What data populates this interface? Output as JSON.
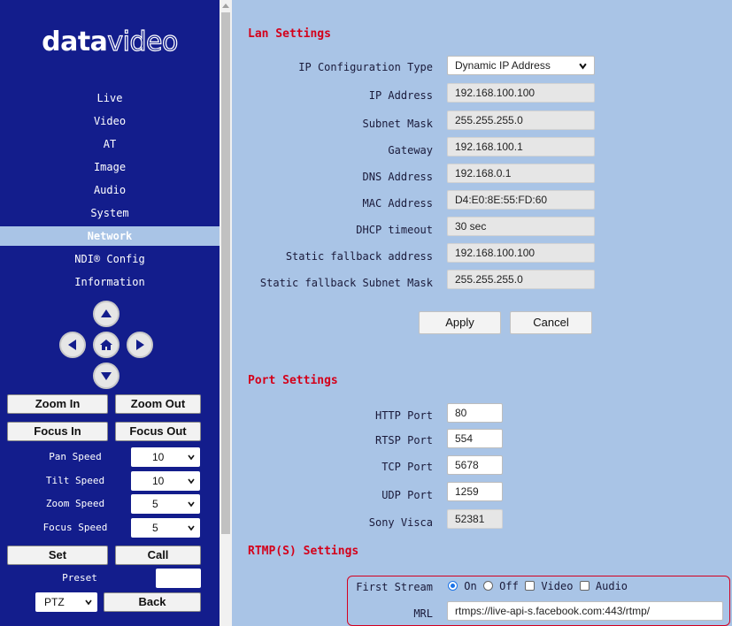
{
  "logo": {
    "bold": "data",
    "thin": "video"
  },
  "nav": {
    "items": [
      {
        "label": "Live"
      },
      {
        "label": "Video"
      },
      {
        "label": "AT"
      },
      {
        "label": "Image"
      },
      {
        "label": "Audio"
      },
      {
        "label": "System"
      },
      {
        "label": "Network",
        "active": true
      },
      {
        "label": "NDI® Config"
      },
      {
        "label": "Information"
      }
    ]
  },
  "ptz": {
    "zoom_in": "Zoom In",
    "zoom_out": "Zoom Out",
    "focus_in": "Focus In",
    "focus_out": "Focus Out",
    "pan_speed": {
      "label": "Pan Speed",
      "value": "10"
    },
    "tilt_speed": {
      "label": "Tilt Speed",
      "value": "10"
    },
    "zoom_speed": {
      "label": "Zoom Speed",
      "value": "5"
    },
    "focus_speed": {
      "label": "Focus Speed",
      "value": "5"
    },
    "set": "Set",
    "call": "Call",
    "preset_label": "Preset",
    "preset_value": "",
    "mode": "PTZ",
    "back": "Back"
  },
  "lan": {
    "title": "Lan Settings",
    "ip_config_type": {
      "label": "IP Configuration Type",
      "value": "Dynamic IP Address"
    },
    "ip_address": {
      "label": "IP Address",
      "value": "192.168.100.100"
    },
    "subnet_mask": {
      "label": "Subnet Mask",
      "value": "255.255.255.0"
    },
    "gateway": {
      "label": "Gateway",
      "value": "192.168.100.1"
    },
    "dns": {
      "label": "DNS Address",
      "value": "192.168.0.1"
    },
    "mac": {
      "label": "MAC Address",
      "value": "D4:E0:8E:55:FD:60"
    },
    "dhcp_timeout": {
      "label": "DHCP timeout",
      "value": "30 sec"
    },
    "static_fallback_address": {
      "label": "Static fallback address",
      "value": "192.168.100.100"
    },
    "static_fallback_subnet": {
      "label": "Static fallback Subnet Mask",
      "value": "255.255.255.0"
    },
    "apply": "Apply",
    "cancel": "Cancel"
  },
  "port": {
    "title": "Port Settings",
    "http": {
      "label": "HTTP Port",
      "value": "80"
    },
    "rtsp": {
      "label": "RTSP Port",
      "value": "554"
    },
    "tcp": {
      "label": "TCP Port",
      "value": "5678"
    },
    "udp": {
      "label": "UDP Port",
      "value": "1259"
    },
    "visca": {
      "label": "Sony Visca",
      "value": "52381"
    }
  },
  "rtmp": {
    "title": "RTMP(S) Settings",
    "first_stream_label": "First Stream",
    "on": "On",
    "off": "Off",
    "video": "Video",
    "audio": "Audio",
    "mrl_label": "MRL",
    "mrl_value": "rtmps://live-api-s.facebook.com:443/rtmp/"
  },
  "colors": {
    "sidebar": "#131d8c",
    "background": "#a9c4e6",
    "section_title": "#d4001a",
    "highlight_box": "#d40020"
  }
}
